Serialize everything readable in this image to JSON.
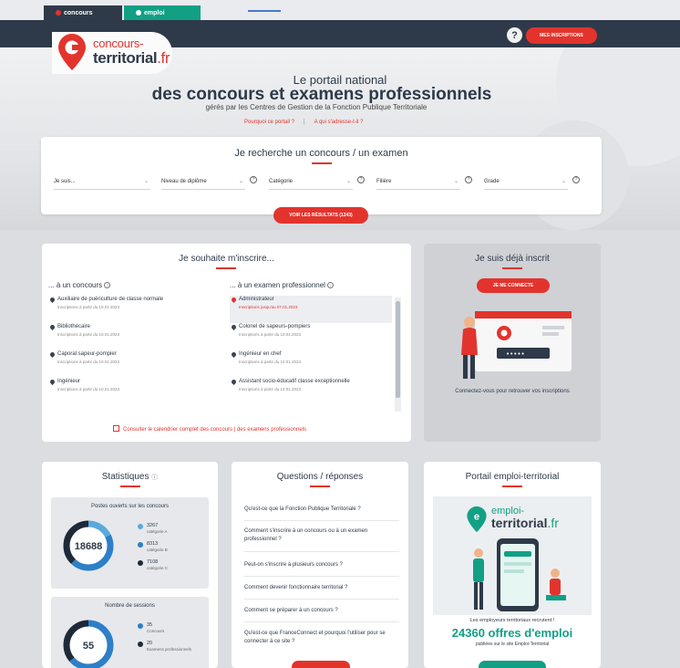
{
  "tabs": {
    "concours": "concours",
    "emploi": "emploi"
  },
  "header": {
    "help": "?",
    "mes_inscriptions": "MES INSCRIPTIONS"
  },
  "logo": {
    "line1": "concours-",
    "line2": "territorial",
    "suffix": ".fr"
  },
  "hero": {
    "kicker": "Le portail national",
    "title": "des concours et examens professionnels",
    "subtitle": "gérés par les Centres de Gestion de la Fonction Publique Territoriale",
    "link1": "Pourquoi ce portail ?",
    "sep": "|",
    "link2": "A qui s'adresse-t-il ?"
  },
  "search": {
    "title": "Je recherche un concours / un examen",
    "filters": [
      "Je suis...",
      "Niveau de diplôme",
      "Catégorie",
      "Filière",
      "Grade"
    ],
    "results_button": "VOIR LES RÉSULTATS (1243)"
  },
  "inscrire": {
    "title": "Je souhaite m'inscrire...",
    "col1_head": "... à un concours",
    "col2_head": "... à un examen professionnel",
    "concours": [
      {
        "name": "Auxiliaire de puériculture de classe normale",
        "date": "Inscriptions à partir du 10.01.2023"
      },
      {
        "name": "Bibliothécaire",
        "date": "Inscriptions à partir du 10.01.2023"
      },
      {
        "name": "Caporal sapeur-pompier",
        "date": "Inscriptions à partir du 10.01.2023"
      },
      {
        "name": "Ingénieur",
        "date": "Inscriptions à partir du 10.01.2023"
      }
    ],
    "examens": [
      {
        "name": "Administrateur",
        "date": "Inscriptions jusqu'au 07.01.2023"
      },
      {
        "name": "Colonel de sapeurs-pompiers",
        "date": "Inscriptions à partir du 10.01.2023"
      },
      {
        "name": "Ingénieur en chef",
        "date": "Inscriptions à partir du 14.01.2023"
      },
      {
        "name": "Assistant socio-éducatif classe exceptionnelle",
        "date": "Inscriptions à partir du 14.01.2023"
      }
    ],
    "calendar_link": "Consulter le calendrier complet des concours | des examens professionnels"
  },
  "deja": {
    "title": "Je suis déjà inscrit",
    "button": "JE ME CONNECTE",
    "caption": "Connectez-vous pour retrouver vos inscriptions"
  },
  "stats": {
    "title": "Statistiques",
    "box1": {
      "title": "Postes ouverts sur les concours",
      "total": "18688",
      "legend": [
        {
          "num": "3267",
          "label": "catégorie A",
          "color": "#5aa9dd"
        },
        {
          "num": "8313",
          "label": "catégorie B",
          "color": "#2d7fc7"
        },
        {
          "num": "7108",
          "label": "catégorie C",
          "color": "#1e2a38"
        }
      ],
      "shares": [
        0.175,
        0.445,
        0.38
      ]
    },
    "box2": {
      "title": "Nombre de sessions",
      "total": "55",
      "legend": [
        {
          "num": "35",
          "label": "Concours",
          "color": "#2d7fc7"
        },
        {
          "num": "20",
          "label": "Examens professionnels",
          "color": "#1e2a38"
        }
      ],
      "shares": [
        0.636,
        0.364
      ]
    }
  },
  "questions": {
    "title": "Questions / réponses",
    "items": [
      "Qu'est-ce que la Fonction Publique Territoriale ?",
      "Comment s'inscrire à un concours ou à un examen professionnel ?",
      "Peut-on s'inscrire à plusieurs concours ?",
      "Comment devenir fonctionnaire territorial ?",
      "Comment se préparer à un concours ?",
      "Qu'est-ce que FranceConnect et pourquoi l'utiliser pour se connecter à ce site ?"
    ]
  },
  "emploi": {
    "title": "Portail emploi-territorial",
    "logo1": "emploi-",
    "logo2": "territorial",
    "logo_suffix": ".fr",
    "line1": "Les employeurs territoriaux recrutent !",
    "line2": "24360 offres d'emploi",
    "line3": "publiées sur le site Emploi-Territorial"
  }
}
